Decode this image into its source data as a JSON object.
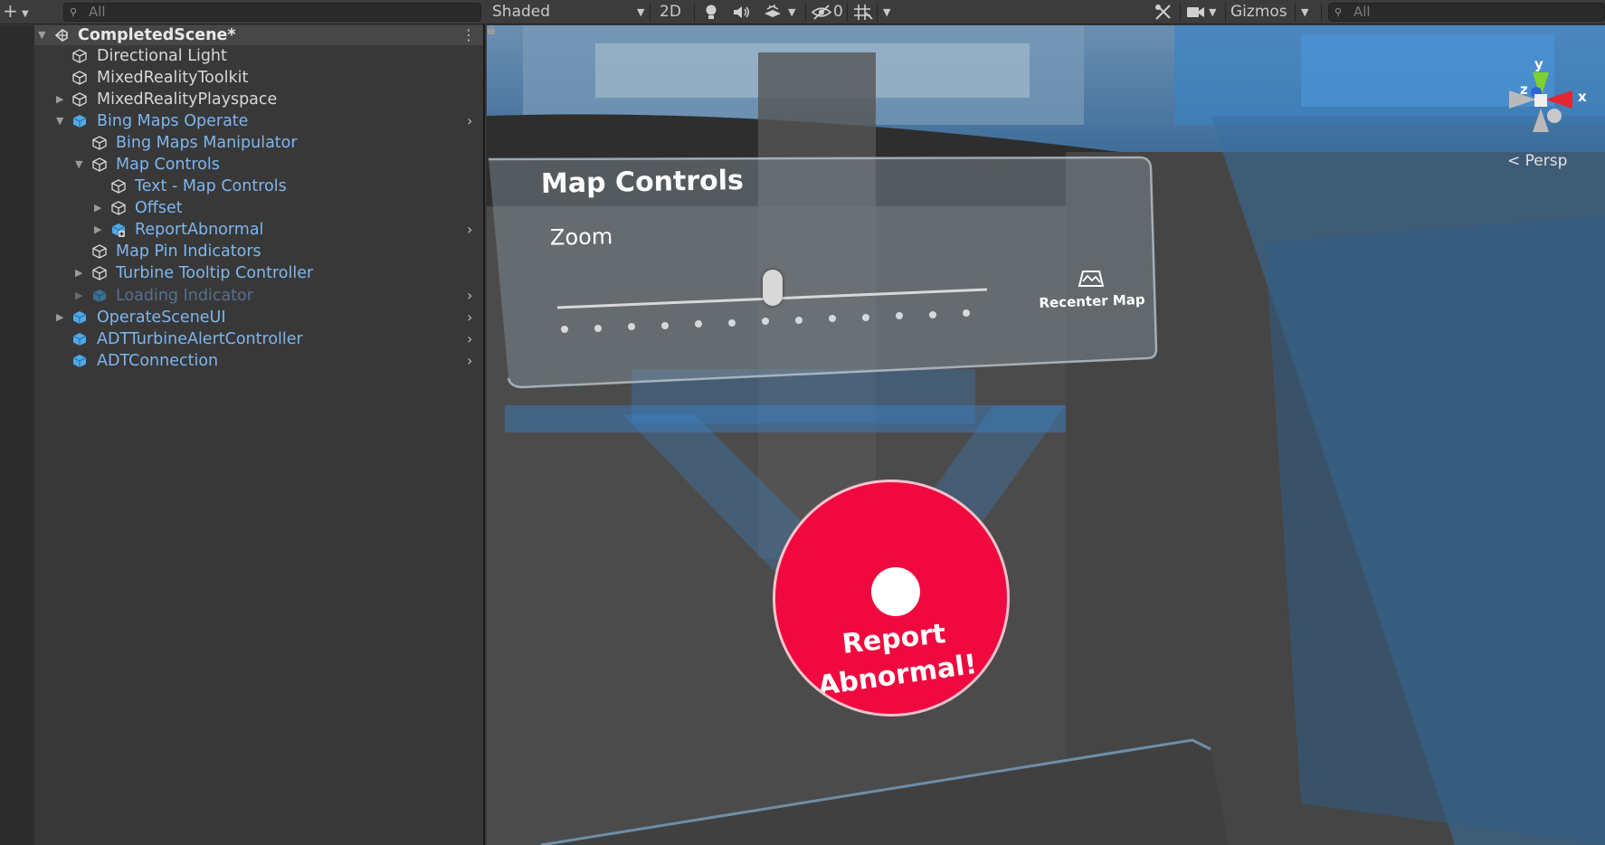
{
  "hierarchy": {
    "search_placeholder": "All",
    "scene_name": "CompletedScene*",
    "items": [
      {
        "label": "Directional Light"
      },
      {
        "label": "MixedRealityToolkit"
      },
      {
        "label": "MixedRealityPlayspace"
      },
      {
        "label": "Bing Maps Operate"
      },
      {
        "label": "Bing Maps Manipulator"
      },
      {
        "label": "Map Controls"
      },
      {
        "label": "Text - Map Controls"
      },
      {
        "label": "Offset"
      },
      {
        "label": "ReportAbnormal"
      },
      {
        "label": "Map Pin Indicators"
      },
      {
        "label": "Turbine Tooltip Controller"
      },
      {
        "label": "Loading Indicator"
      },
      {
        "label": "OperateSceneUI"
      },
      {
        "label": "ADTTurbineAlertController"
      },
      {
        "label": "ADTConnection"
      }
    ]
  },
  "scene_toolbar": {
    "draw_mode": "Shaded",
    "view_2d": "2D",
    "hidden_count": "0",
    "gizmos": "Gizmos",
    "search_placeholder": "All"
  },
  "viewport": {
    "map_controls_title": "Map Controls",
    "zoom_label": "Zoom",
    "zoom_level": 0.5,
    "recenter_label": "Recenter Map",
    "report_button_line1": "Report",
    "report_button_line2": "Abnormal!",
    "projection_label": "Persp",
    "gizmo_axes": {
      "x": "x",
      "y": "y",
      "z": "z"
    }
  },
  "colors": {
    "selected_text": "#7fb6ee",
    "disabled_text": "#56708f",
    "report_button": "#f0093e",
    "panel_bg": "#383838"
  }
}
